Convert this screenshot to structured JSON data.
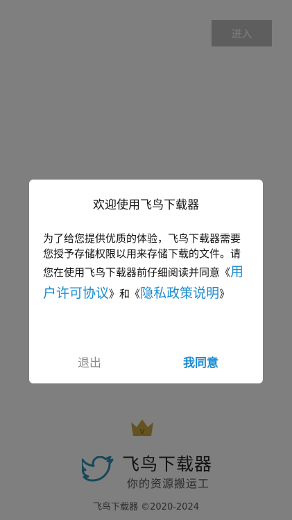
{
  "header": {
    "enter_label": "进入"
  },
  "brand": {
    "app_name": "飞鸟下载器",
    "slogan": "你的资源搬运工",
    "copyright": "飞鸟下载器 ©2020-2024",
    "crown_letter": "V",
    "icons": {
      "crown": "crown-icon",
      "bird": "bird-logo-icon"
    },
    "colors": {
      "crown": "#c9a441",
      "bird": "#2f8fb0"
    }
  },
  "dialog": {
    "title": "欢迎使用飞鸟下载器",
    "body_text_1": "为了给您提供优质的体验，飞鸟下载器需要您授予存储权限以用来存储下载的文件。请您在使用飞鸟下载器前仔细阅读并同意",
    "link_open_1": "《",
    "link_1": "用户许可协议",
    "link_close_1": "》",
    "conjunction": "和",
    "link_open_2": "《",
    "link_2": "隐私政策说明",
    "link_close_2": "》",
    "exit_label": "退出",
    "agree_label": "我同意",
    "colors": {
      "link": "#1a8ccf",
      "exit": "#8a8a8a"
    }
  }
}
